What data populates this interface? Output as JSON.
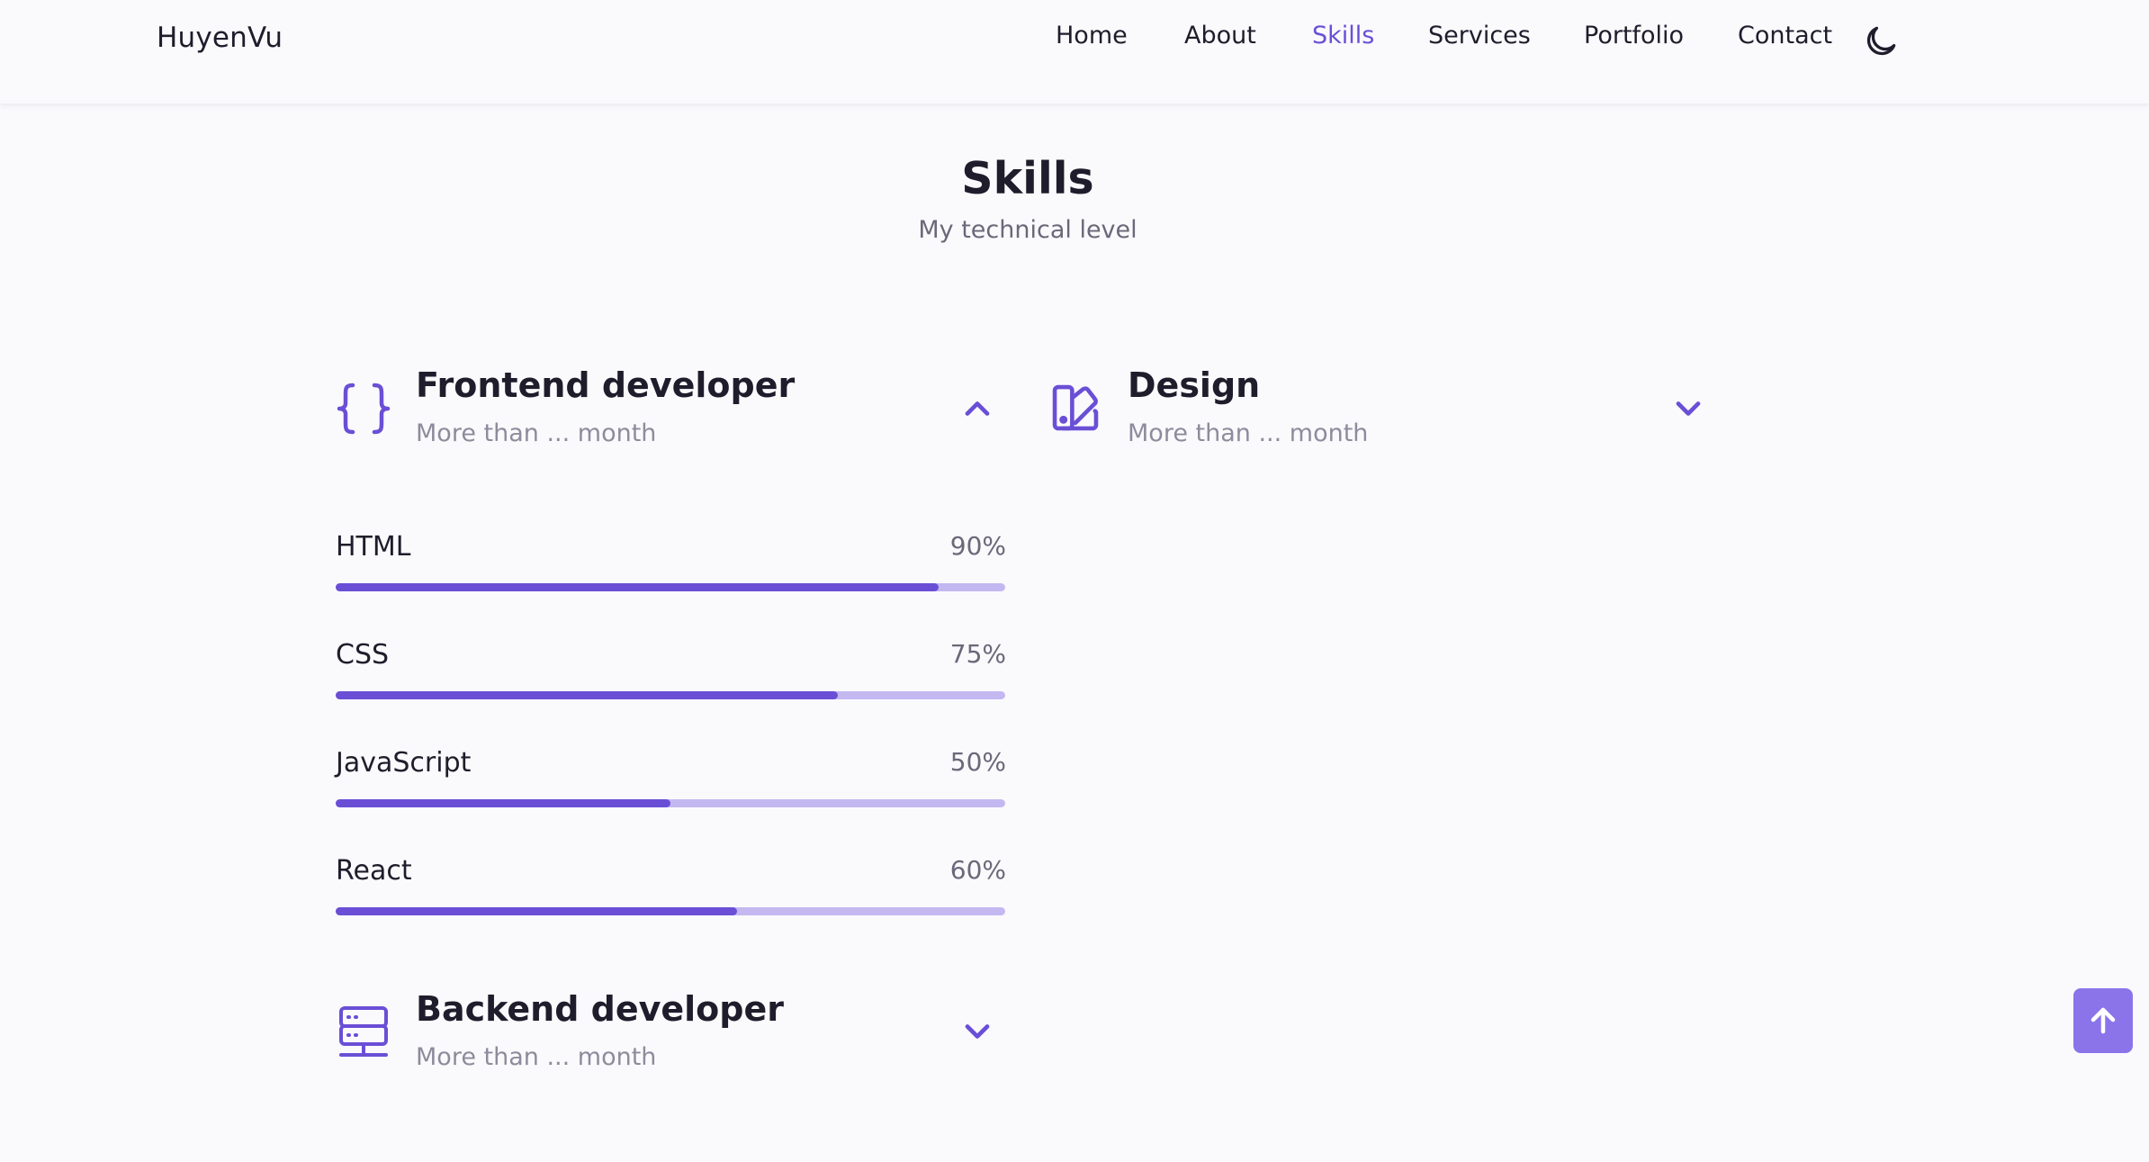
{
  "header": {
    "logo": "HuyenVu",
    "nav": [
      {
        "label": "Home"
      },
      {
        "label": "About"
      },
      {
        "label": "Skills"
      },
      {
        "label": "Services"
      },
      {
        "label": "Portfolio"
      },
      {
        "label": "Contact"
      }
    ],
    "active_nav": "Skills",
    "theme_icon": "moon-icon"
  },
  "section": {
    "title": "Skills",
    "subtitle": "My technical level"
  },
  "groups": [
    {
      "title": "Frontend developer",
      "subtitle": "More than ... month",
      "icon": "braces-icon",
      "expanded": true,
      "skills": [
        {
          "name": "HTML",
          "percent_label": "90%",
          "percent": 90
        },
        {
          "name": "CSS",
          "percent_label": "75%",
          "percent": 75
        },
        {
          "name": "JavaScript",
          "percent_label": "50%",
          "percent": 50
        },
        {
          "name": "React",
          "percent_label": "60%",
          "percent": 60
        }
      ]
    },
    {
      "title": "Design",
      "subtitle": "More than ... month",
      "icon": "swatchbook-icon",
      "expanded": false
    },
    {
      "title": "Backend developer",
      "subtitle": "More than ... month",
      "icon": "server-icon",
      "expanded": false
    }
  ],
  "colors": {
    "accent": "#6a4fd6",
    "accent_light": "#c4b8f1",
    "scroll_button": "#8b74ea",
    "background": "#fafafd"
  },
  "scroll_up_icon": "arrow-up-icon"
}
